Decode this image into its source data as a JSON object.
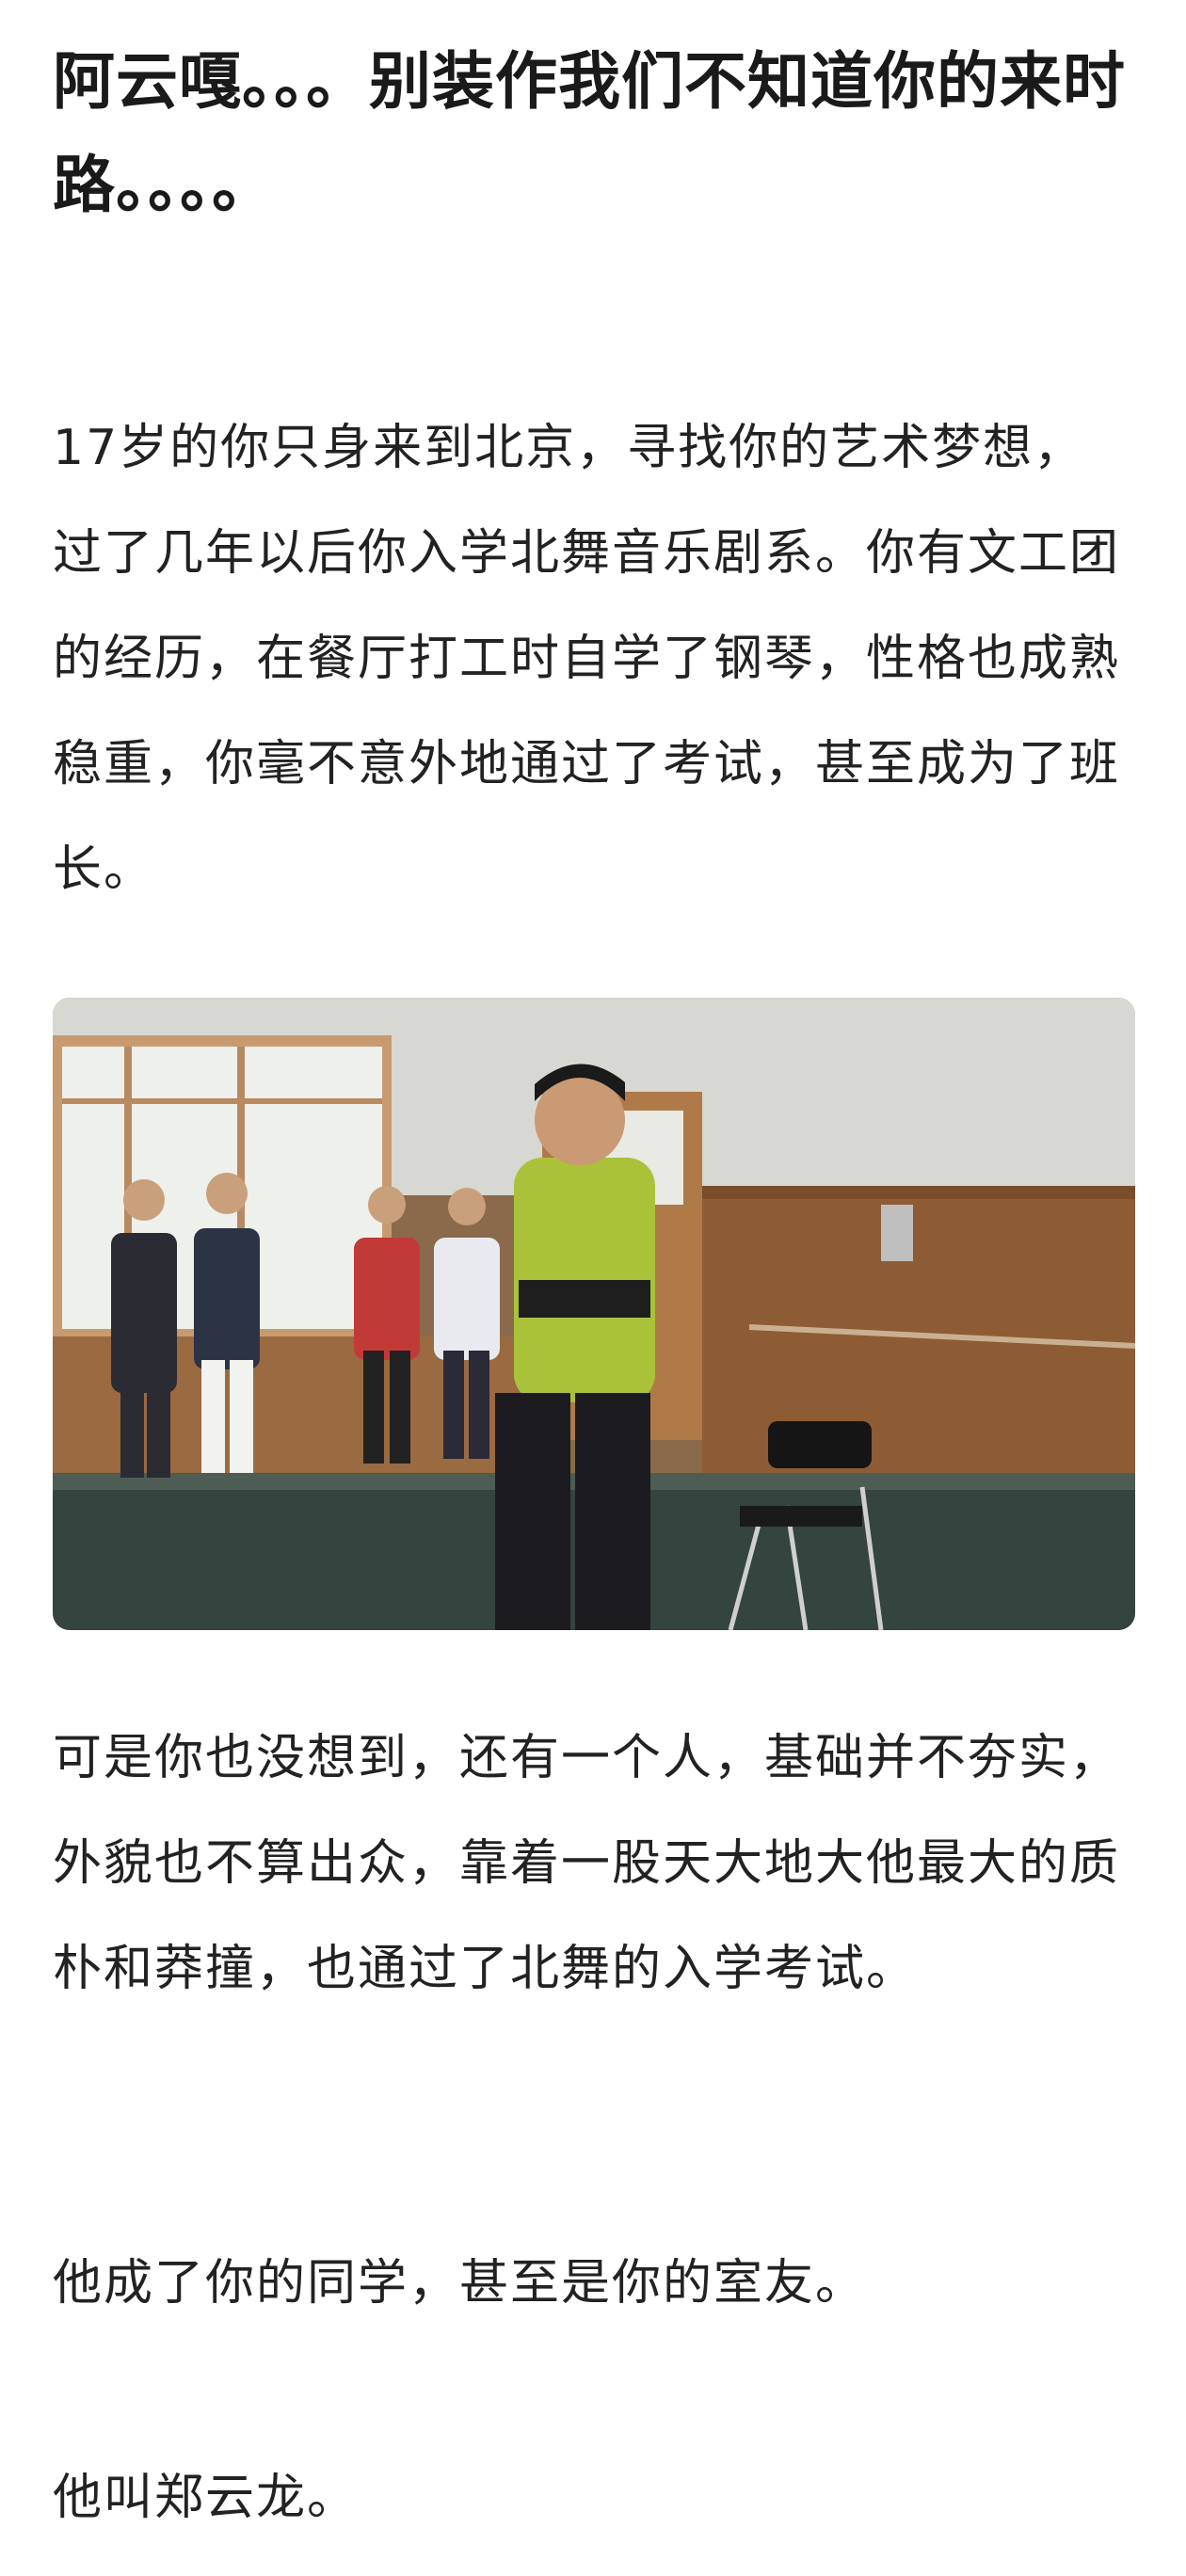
{
  "article": {
    "title": "阿云嘎。。。别装作我们不知道你的来时路。。。。",
    "paragraphs": [
      "17岁的你只身来到北京，寻找你的艺术梦想，过了几年以后你入学北舞音乐剧系。你有文工团的经历，在餐厅打工时自学了钢琴，性格也成熟稳重，你毫不意外地通过了考试，甚至成为了班长。",
      "可是你也没想到，还有一个人，基础并不夯实，外貌也不算出众，靠着一股天大地大他最大的质朴和莽撞，也通过了北舞的入学考试。",
      "他成了你的同学，甚至是你的室友。",
      "他叫郑云龙。"
    ]
  },
  "photo": {
    "description_icon": "photo-dance-studio"
  }
}
